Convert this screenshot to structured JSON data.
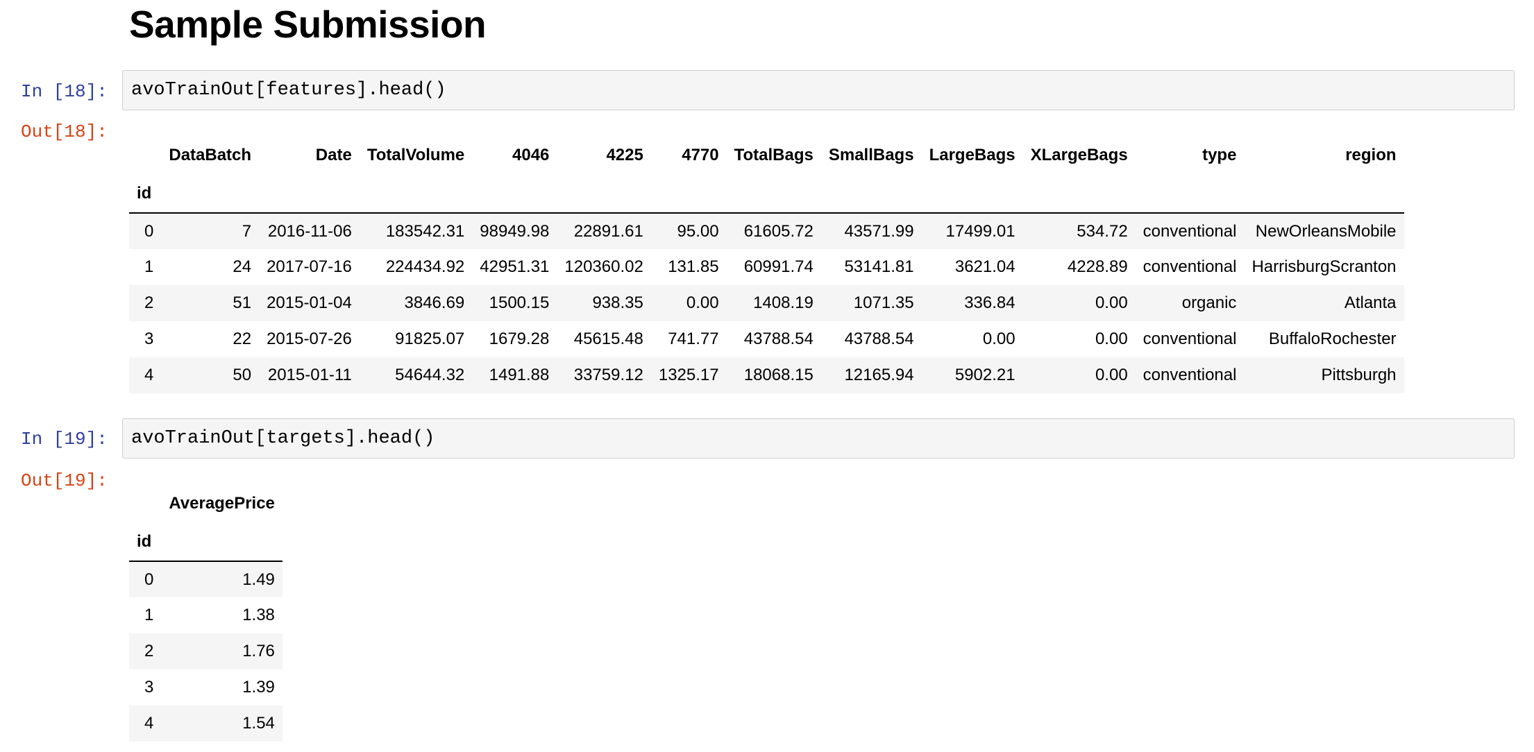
{
  "heading": "Sample Submission",
  "cells": {
    "c18": {
      "in_prompt": "In [18]:",
      "code": "avoTrainOut[features].head()",
      "out_prompt": "Out[18]:",
      "index_name": "id",
      "columns": [
        "DataBatch",
        "Date",
        "TotalVolume",
        "4046",
        "4225",
        "4770",
        "TotalBags",
        "SmallBags",
        "LargeBags",
        "XLargeBags",
        "type",
        "region"
      ],
      "rows": [
        {
          "id": "0",
          "cells": [
            "7",
            "2016-11-06",
            "183542.31",
            "98949.98",
            "22891.61",
            "95.00",
            "61605.72",
            "43571.99",
            "17499.01",
            "534.72",
            "conventional",
            "NewOrleansMobile"
          ]
        },
        {
          "id": "1",
          "cells": [
            "24",
            "2017-07-16",
            "224434.92",
            "42951.31",
            "120360.02",
            "131.85",
            "60991.74",
            "53141.81",
            "3621.04",
            "4228.89",
            "conventional",
            "HarrisburgScranton"
          ]
        },
        {
          "id": "2",
          "cells": [
            "51",
            "2015-01-04",
            "3846.69",
            "1500.15",
            "938.35",
            "0.00",
            "1408.19",
            "1071.35",
            "336.84",
            "0.00",
            "organic",
            "Atlanta"
          ]
        },
        {
          "id": "3",
          "cells": [
            "22",
            "2015-07-26",
            "91825.07",
            "1679.28",
            "45615.48",
            "741.77",
            "43788.54",
            "43788.54",
            "0.00",
            "0.00",
            "conventional",
            "BuffaloRochester"
          ]
        },
        {
          "id": "4",
          "cells": [
            "50",
            "2015-01-11",
            "54644.32",
            "1491.88",
            "33759.12",
            "1325.17",
            "18068.15",
            "12165.94",
            "5902.21",
            "0.00",
            "conventional",
            "Pittsburgh"
          ]
        }
      ]
    },
    "c19": {
      "in_prompt": "In [19]:",
      "code": "avoTrainOut[targets].head()",
      "out_prompt": "Out[19]:",
      "index_name": "id",
      "columns": [
        "AveragePrice"
      ],
      "rows": [
        {
          "id": "0",
          "cells": [
            "1.49"
          ]
        },
        {
          "id": "1",
          "cells": [
            "1.38"
          ]
        },
        {
          "id": "2",
          "cells": [
            "1.76"
          ]
        },
        {
          "id": "3",
          "cells": [
            "1.39"
          ]
        },
        {
          "id": "4",
          "cells": [
            "1.54"
          ]
        }
      ]
    }
  }
}
